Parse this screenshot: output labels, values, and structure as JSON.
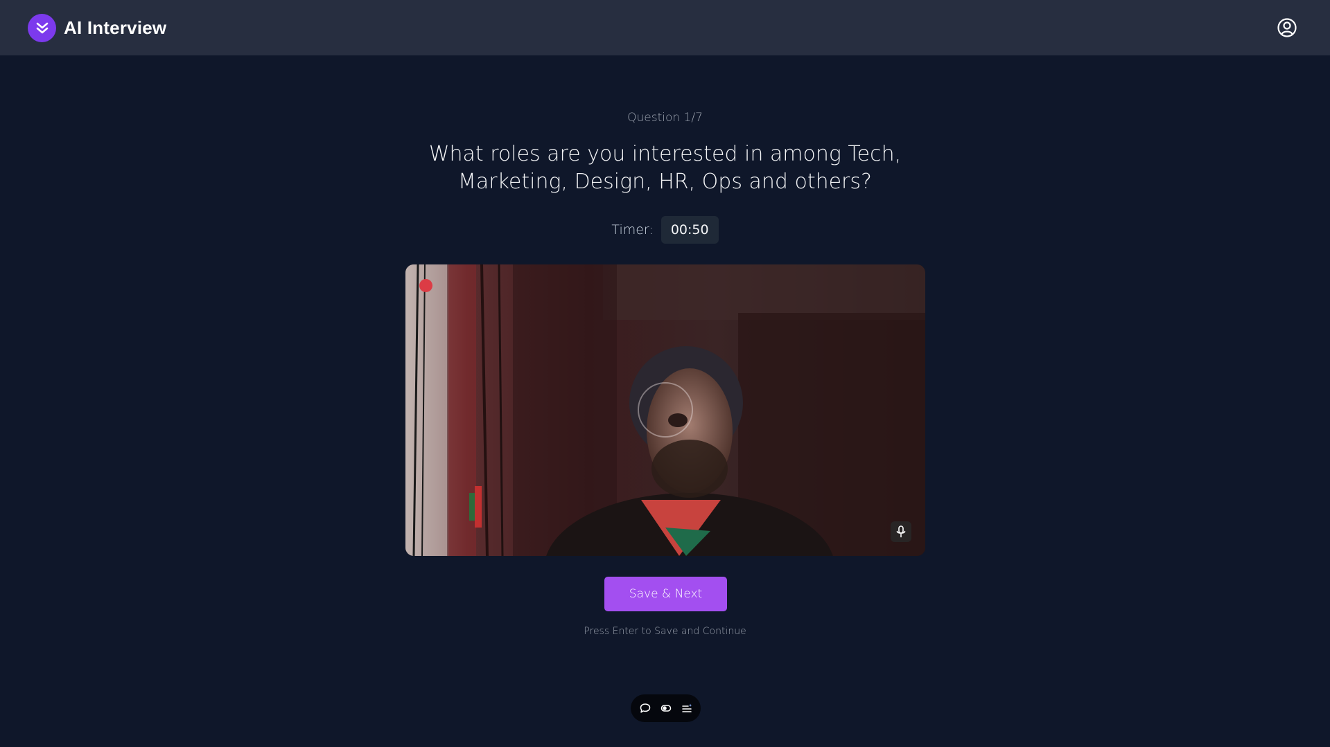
{
  "app": {
    "title": "AI Interview"
  },
  "header": {
    "profile_icon": "user-circle-icon",
    "logo_icon": "double-chevron-down-icon"
  },
  "question": {
    "counter": "Question 1/7",
    "line1": "What roles are you interested in among Tech,",
    "line2": "Marketing, Design, HR, Ops and others?"
  },
  "timer": {
    "label": "Timer:",
    "value": "00:50"
  },
  "video": {
    "recording_indicator": "red-dot",
    "mic_icon": "microphone-icon"
  },
  "actions": {
    "save_next_label": "Save & Next",
    "hint": "Press Enter to Save and Continue"
  },
  "toolbar": {
    "icons": [
      "chat-bubble-icon",
      "toggle-icon",
      "list-sparkle-icon"
    ]
  },
  "colors": {
    "background": "#0f172a",
    "topbar": "#272e40",
    "accent": "#a34ff0",
    "logo": "#7c3aed",
    "record": "#dc3c45"
  }
}
